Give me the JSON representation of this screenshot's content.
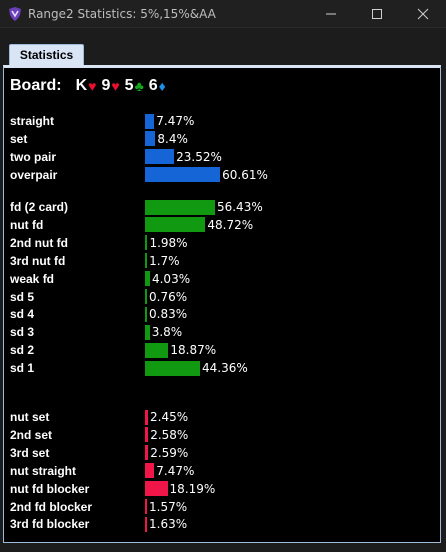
{
  "window": {
    "title": "Range2 Statistics: 5%,15%&AA",
    "icon": "shield-logo-icon",
    "controls": [
      "minimize-icon",
      "maximize-icon",
      "close-icon"
    ]
  },
  "tab": {
    "label": "Statistics"
  },
  "board": {
    "label": "Board:",
    "cards": [
      {
        "rank": "K",
        "suit": "♥",
        "suit_name": "heart-icon",
        "color": "#e8112d"
      },
      {
        "rank": "9",
        "suit": "♥",
        "suit_name": "heart-icon",
        "color": "#e8112d"
      },
      {
        "rank": "5",
        "suit": "♣",
        "suit_name": "club-icon",
        "color": "#12a61a"
      },
      {
        "rank": "6",
        "suit": "♦",
        "suit_name": "diamond-icon",
        "color": "#1f8fe8"
      }
    ]
  },
  "colors": {
    "made": "#1565d6",
    "draws": "#119911",
    "blockers": "#f0164a"
  },
  "groups": [
    {
      "name": "made",
      "rows": [
        {
          "label": "straight",
          "value": 7.47,
          "text": "7.47%"
        },
        {
          "label": "set",
          "value": 8.4,
          "text": "8.4%"
        },
        {
          "label": "two pair",
          "value": 23.52,
          "text": "23.52%"
        },
        {
          "label": "overpair",
          "value": 60.61,
          "text": "60.61%"
        }
      ]
    },
    {
      "name": "draws",
      "rows": [
        {
          "label": "fd (2 card)",
          "value": 56.43,
          "text": "56.43%"
        },
        {
          "label": "nut fd",
          "value": 48.72,
          "text": "48.72%"
        },
        {
          "label": "2nd nut fd",
          "value": 1.98,
          "text": "1.98%"
        },
        {
          "label": "3rd nut fd",
          "value": 1.7,
          "text": "1.7%"
        },
        {
          "label": "weak fd",
          "value": 4.03,
          "text": "4.03%"
        },
        {
          "label": "sd 5",
          "value": 0.76,
          "text": "0.76%"
        },
        {
          "label": "sd 4",
          "value": 0.83,
          "text": "0.83%"
        },
        {
          "label": "sd 3",
          "value": 3.8,
          "text": "3.8%"
        },
        {
          "label": "sd 2",
          "value": 18.87,
          "text": "18.87%"
        },
        {
          "label": "sd 1",
          "value": 44.36,
          "text": "44.36%"
        }
      ]
    },
    {
      "name": "blockers",
      "rows": [
        {
          "label": "nut set",
          "value": 2.45,
          "text": "2.45%"
        },
        {
          "label": "2nd set",
          "value": 2.58,
          "text": "2.58%"
        },
        {
          "label": "3rd set",
          "value": 2.59,
          "text": "2.59%"
        },
        {
          "label": "nut straight",
          "value": 7.47,
          "text": "7.47%"
        },
        {
          "label": "nut fd blocker",
          "value": 18.19,
          "text": "18.19%"
        },
        {
          "label": "2nd fd blocker",
          "value": 1.57,
          "text": "1.57%"
        },
        {
          "label": "3rd fd blocker",
          "value": 1.63,
          "text": "1.63%"
        }
      ]
    }
  ]
}
